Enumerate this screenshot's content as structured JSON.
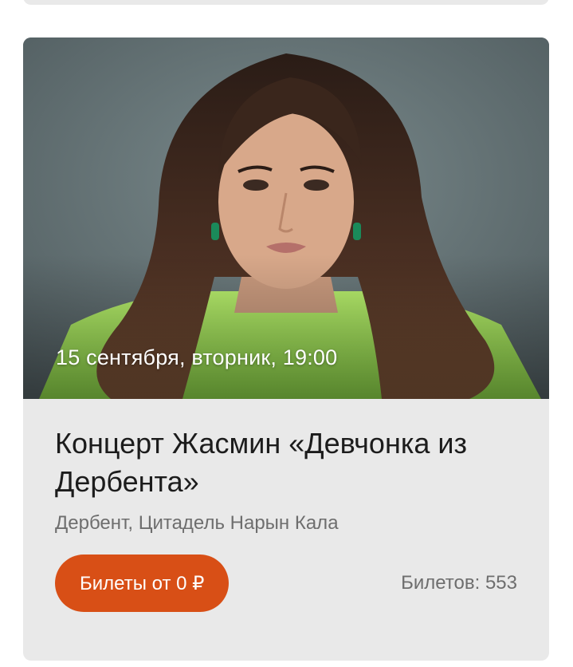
{
  "event": {
    "date": "15 сентября, вторник, 19:00",
    "title": "Концерт Жасмин «Девчонка из Дербента»",
    "venue": "Дербент, Цитадель Нарын Кала",
    "tickets_button_label": "Билеты от 0 ₽",
    "tickets_count_label": "Билетов: 553"
  },
  "colors": {
    "card_background": "#e9e9e9",
    "button_accent": "#d84f16",
    "photo_backdrop": "#5f6d70",
    "jacket_green": "#9ee05a"
  },
  "icons": {
    "photo": "event-photo-portrait"
  }
}
